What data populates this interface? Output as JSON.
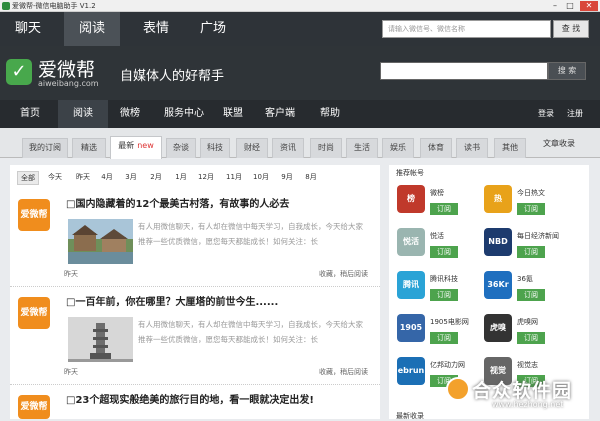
{
  "window": {
    "title": "爱微帮-微信电脑助手 V1.2"
  },
  "top_nav": {
    "tabs": [
      "聊天",
      "阅读",
      "表情",
      "广场"
    ],
    "search_placeholder": "请输入微信号、微信名称",
    "search_button": "查 找"
  },
  "banner": {
    "logo_text": "爱微帮",
    "logo_url": "aiweibang.com",
    "slogan": "自媒体人的好帮手",
    "search_button": "搜 索"
  },
  "main_nav": {
    "items": [
      "首页",
      "阅读",
      "微榜",
      "服务中心",
      "联盟",
      "客户端",
      "帮助"
    ],
    "login": "登录",
    "register": "注册"
  },
  "categories": {
    "items": [
      "我的订阅",
      "精选",
      "最新",
      "杂谈",
      "科技",
      "财经",
      "资讯",
      "时尚",
      "生活",
      "娱乐",
      "体育",
      "读书",
      "其他"
    ],
    "new_badge": "new",
    "archive": "文章收录"
  },
  "months": [
    "全部",
    "今天",
    "昨天",
    "4月",
    "3月",
    "2月",
    "1月",
    "12月",
    "11月",
    "10月",
    "9月",
    "8月"
  ],
  "articles": [
    {
      "icon": "爱微帮",
      "title": "□国内隐藏着的12个最美古村落，有故事的人必去",
      "excerpt": "有人用微信聊天，有人却在微信中每天学习，自我成长，今天给大家推荐一些优质微信，愿您每天都能成长！如何关注：长",
      "date": "昨天",
      "actions": "收藏，稍后阅读"
    },
    {
      "icon": "爱微帮",
      "title": "□一百年前，你在哪里？大厘塔的前世今生......",
      "excerpt": "有人用微信聊天，有人却在微信中每天学习，自我成长，今天给大家推荐一些优质微信，愿您每天都能成长！如何关注：长",
      "date": "昨天",
      "actions": "收藏，稍后阅读"
    },
    {
      "icon": "爱微帮",
      "title": "□23个超现实般绝美的旅行目的地，看一眼就决定出发!"
    }
  ],
  "sidebar": {
    "title": "推荐帐号",
    "follow_label": "订阅",
    "accounts": [
      {
        "name": "微榜",
        "logo": "榜",
        "color": "#c0392b"
      },
      {
        "name": "今日热文",
        "logo": "热",
        "color": "#e8a21a"
      },
      {
        "name": "悦活",
        "logo": "悦活",
        "color": "#9ab5b0"
      },
      {
        "name": "每日经济新闻",
        "logo": "NBD",
        "color": "#1d3b6e"
      },
      {
        "name": "腾讯科技",
        "logo": "腾讯",
        "color": "#2aa3d6"
      },
      {
        "name": "36氪",
        "logo": "36Kr",
        "color": "#1f6fbf"
      },
      {
        "name": "1905电影网",
        "logo": "1905",
        "color": "#3566a8"
      },
      {
        "name": "虎嗅网",
        "logo": "虎嗅",
        "color": "#333333"
      },
      {
        "name": "亿邦动力网",
        "logo": "ebrun",
        "color": "#1b6fb5"
      },
      {
        "name": "视觉志",
        "logo": "视觉",
        "color": "#666666"
      }
    ],
    "bottom_title": "最新收录"
  },
  "watermark": {
    "text": "合众软件园",
    "url": "www.hezhong.net"
  }
}
